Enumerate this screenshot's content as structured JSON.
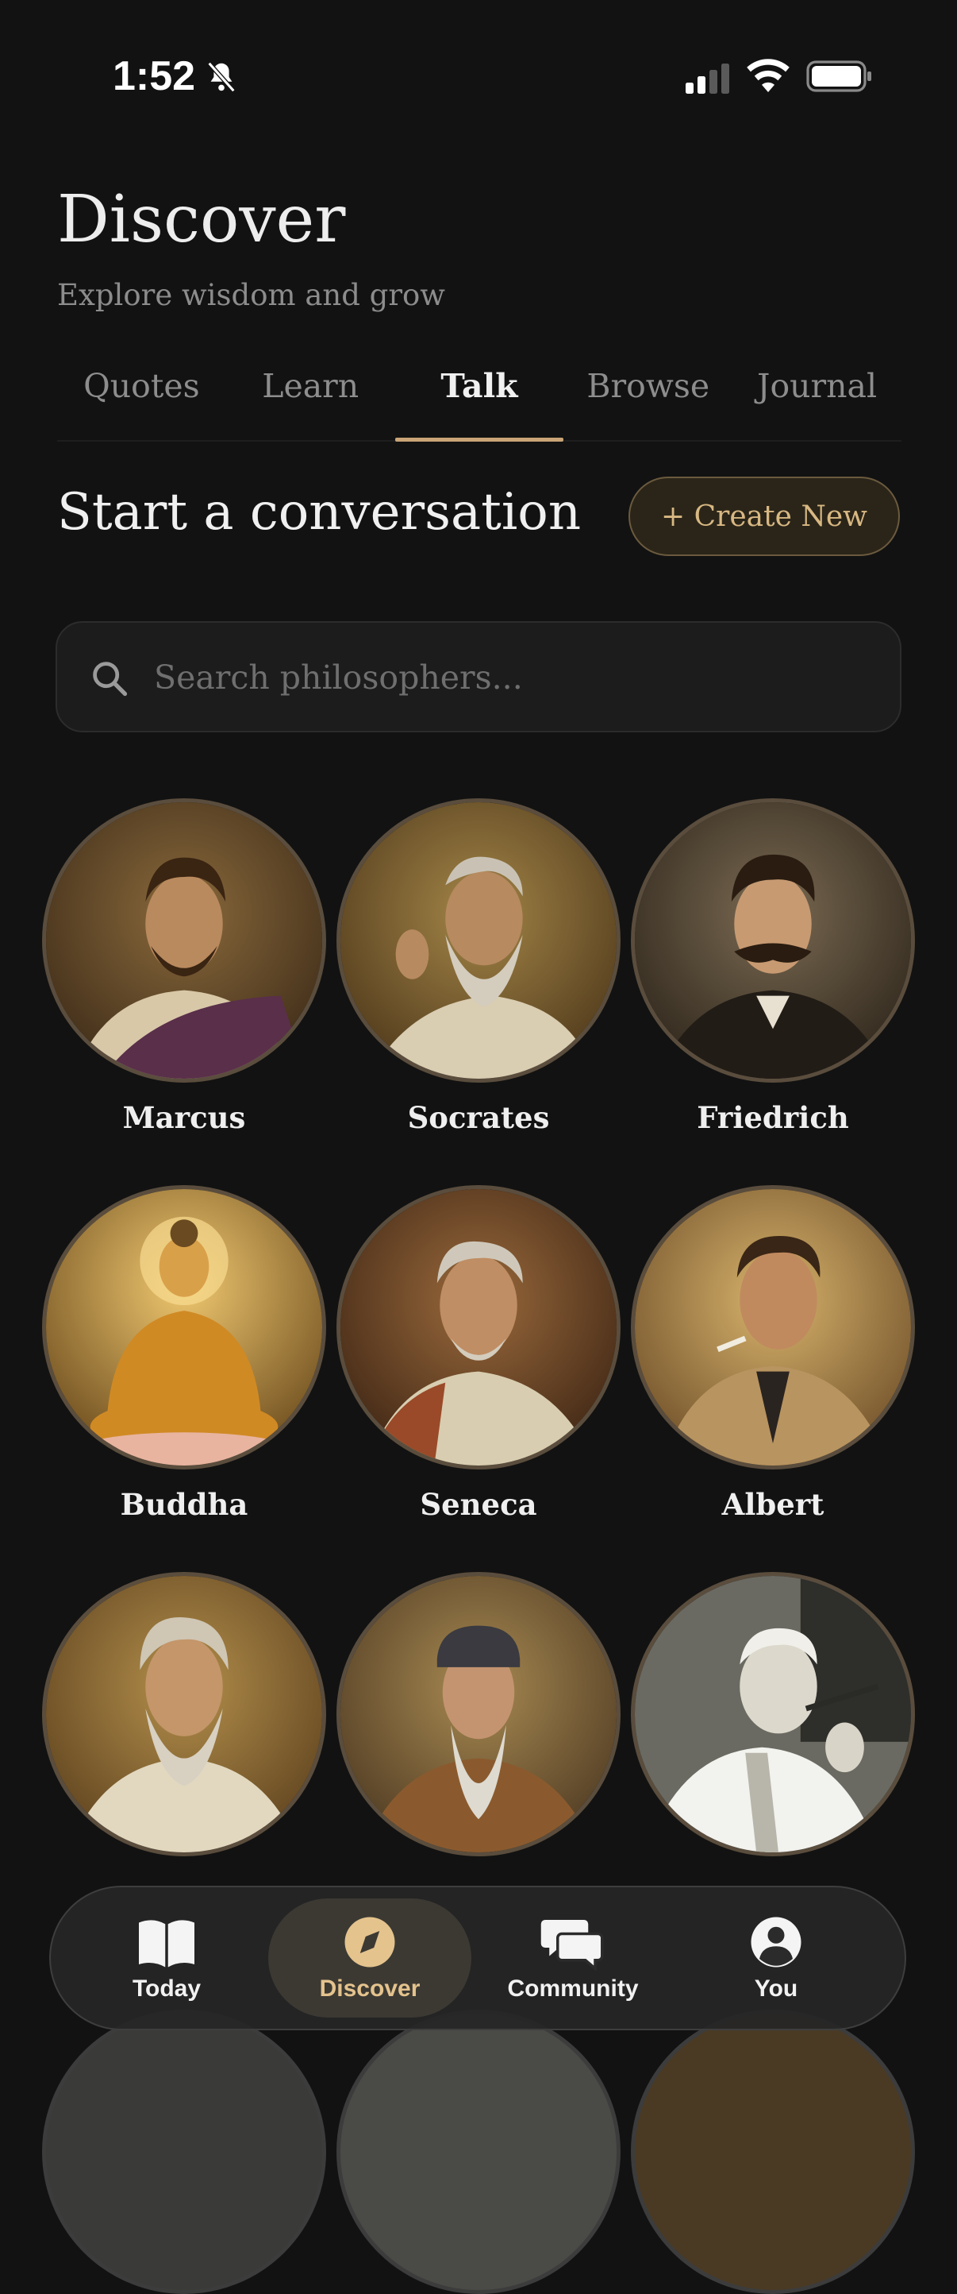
{
  "status": {
    "time": "1:52"
  },
  "header": {
    "title": "Discover",
    "subtitle": "Explore wisdom and grow"
  },
  "tabs": [
    {
      "label": "Quotes",
      "active": false
    },
    {
      "label": "Learn",
      "active": false
    },
    {
      "label": "Talk",
      "active": true
    },
    {
      "label": "Browse",
      "active": false
    },
    {
      "label": "Journal",
      "active": false
    }
  ],
  "section": {
    "title": "Start a conversation",
    "create_label": "+ Create New"
  },
  "search": {
    "placeholder": "Search philosophers..."
  },
  "philosophers": [
    {
      "name": "Marcus",
      "palette": "roman-purple"
    },
    {
      "name": "Socrates",
      "palette": "gold-elder"
    },
    {
      "name": "Friedrich",
      "palette": "dark-mustache"
    },
    {
      "name": "Buddha",
      "palette": "golden-buddha"
    },
    {
      "name": "Seneca",
      "palette": "warm-elder"
    },
    {
      "name": "Albert",
      "palette": "trenchcoat"
    },
    {
      "name": "",
      "palette": "white-beard"
    },
    {
      "name": "",
      "palette": "sage-robe"
    },
    {
      "name": "",
      "palette": "monochrome-pipe"
    }
  ],
  "nav": [
    {
      "label": "Today",
      "icon": "book-icon",
      "active": false
    },
    {
      "label": "Discover",
      "icon": "compass-icon",
      "active": true
    },
    {
      "label": "Community",
      "icon": "chat-bubbles-icon",
      "active": false
    },
    {
      "label": "You",
      "icon": "person-icon",
      "active": false
    }
  ],
  "colors": {
    "background": "#121212",
    "accent": "#caa476",
    "create_border": "#6b5a3e"
  }
}
